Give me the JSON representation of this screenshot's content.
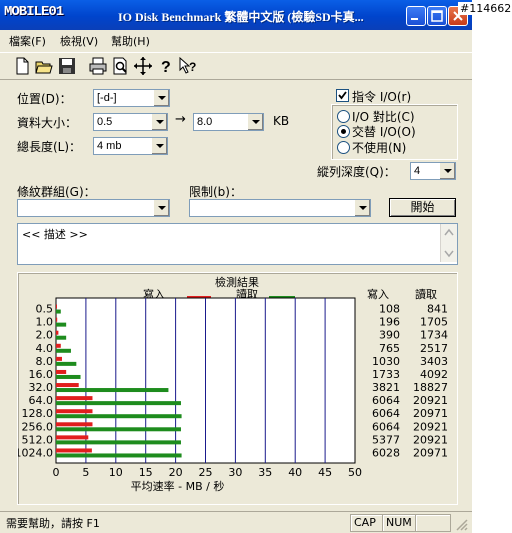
{
  "window": {
    "logo": "MOBILE01",
    "title": "IO Disk Benchmark  繁體中文版 (檢驗SD卡真...",
    "watermark": "#114662"
  },
  "menu": [
    "檔案(F)",
    "檢視(V)",
    "幫助(H)"
  ],
  "toolbar_icons": [
    "new-icon",
    "open-icon",
    "save-icon",
    "print-icon",
    "preview-icon",
    "move-icon",
    "help-icon",
    "context-help-icon"
  ],
  "form": {
    "position_label": "位置(D)：",
    "position_value": "[-d-]",
    "size_label": "資料大小：",
    "size_from": "0.5",
    "size_to": "8.0",
    "size_unit": "KB",
    "arrow": "→",
    "length_label": "總長度(L)：",
    "length_value": "4 mb",
    "direct_io_label": "指令 I/O(r)",
    "direct_io_checked": true,
    "io_compare_label": "I/O 對比(C)",
    "alt_io_label": "交替 I/O(O)",
    "not_used_label": "不使用(N)",
    "queue_label": "縱列深度(Q)：",
    "queue_value": "4",
    "stripe_label": "條紋群組(G)：",
    "stripe_value": "",
    "limit_label": "限制(b)：",
    "limit_value": "",
    "start_button": "開始",
    "description": "<< 描述 >>"
  },
  "result_title": "檢測結果",
  "legend_write": "寫入",
  "legend_read": "讀取",
  "col_write": "寫入",
  "col_read": "讀取",
  "xlabel": "平均速率 - MB / 秒",
  "chart_data": {
    "type": "bar",
    "title": "檢測結果",
    "xlabel": "平均速率 - MB / 秒",
    "ylabel": "",
    "categories": [
      "0.5",
      "1.0",
      "2.0",
      "4.0",
      "8.0",
      "16.0",
      "32.0",
      "64.0",
      "128.0",
      "256.0",
      "512.0",
      "1024.0"
    ],
    "series": [
      {
        "name": "寫入",
        "color": "#e11e1e",
        "values": [
          0.1,
          0.2,
          0.4,
          0.8,
          1.0,
          1.7,
          3.8,
          6.1,
          6.1,
          6.1,
          5.4,
          6.0
        ]
      },
      {
        "name": "讀取",
        "color": "#1e8c1e",
        "values": [
          0.8,
          1.7,
          1.7,
          2.5,
          3.4,
          4.1,
          18.8,
          20.9,
          21.0,
          20.9,
          20.9,
          21.0
        ]
      }
    ],
    "write_kb": [
      "108",
      "196",
      "390",
      "765",
      "1030",
      "1733",
      "3821",
      "6064",
      "6064",
      "6064",
      "5377",
      "6028"
    ],
    "read_kb": [
      "841",
      "1705",
      "1734",
      "2517",
      "3403",
      "4092",
      "18827",
      "20921",
      "20971",
      "20921",
      "20921",
      "20971"
    ],
    "xlim": [
      0,
      50
    ],
    "xticks": [
      "0",
      "5",
      "10",
      "15",
      "20",
      "25",
      "30",
      "35",
      "40",
      "45",
      "50"
    ],
    "orientation": "horizontal",
    "grid": true
  },
  "status": {
    "text": "需要幫助，請按 F1",
    "cap": "CAP",
    "num": "NUM"
  }
}
